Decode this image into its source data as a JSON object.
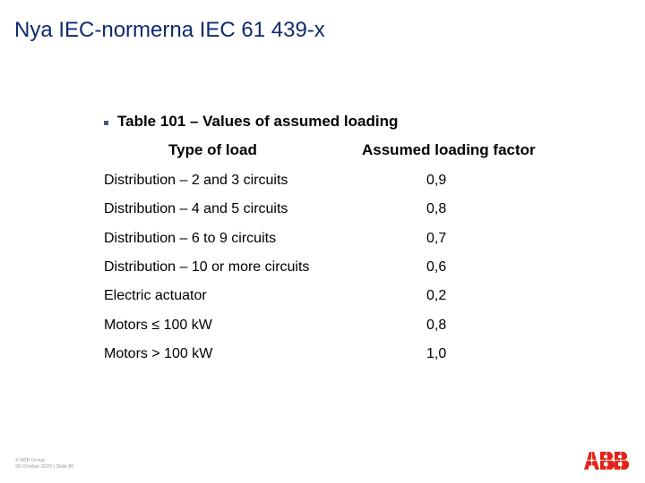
{
  "slide": {
    "title": "Nya IEC-normerna IEC 61 439-x",
    "bullet": "Table 101 – Values of assumed loading",
    "table": {
      "headers": {
        "type": "Type of load",
        "factor": "Assumed loading factor"
      },
      "rows": [
        {
          "type": "Distribution – 2 and 3 circuits",
          "factor": "0,9"
        },
        {
          "type": "Distribution – 4 and 5 circuits",
          "factor": "0,8"
        },
        {
          "type": "Distribution – 6 to 9 circuits",
          "factor": "0,7"
        },
        {
          "type": "Distribution – 10 or more circuits",
          "factor": "0,6"
        },
        {
          "type": "Electric actuator",
          "factor": "0,2"
        },
        {
          "type": "Motors ≤ 100 kW",
          "factor": "0,8"
        },
        {
          "type": "Motors > 100 kW",
          "factor": "1,0"
        }
      ]
    }
  },
  "footer": {
    "line1": "© ABB Group",
    "line2": "28 October 2020 | Slide 80"
  },
  "logo": {
    "text": "ABB",
    "color": "#e2231a"
  },
  "colors": {
    "title": "#0f2a6e",
    "body_text": "#000000"
  }
}
